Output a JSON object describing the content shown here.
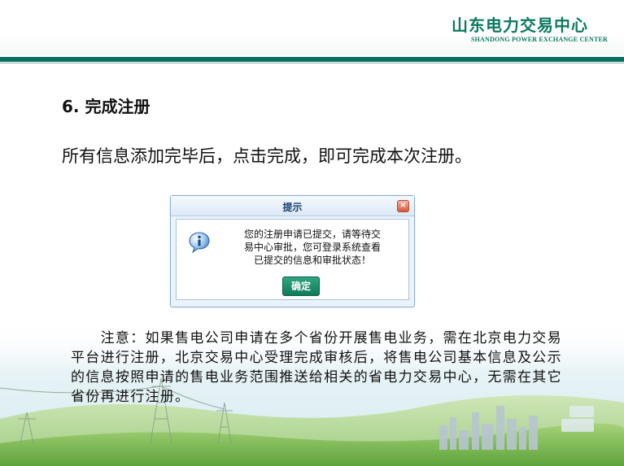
{
  "header": {
    "logo_cn": "山东电力交易中心",
    "logo_en": "SHANDONG POWER EXCHANGE CENTER"
  },
  "section": {
    "title": "6. 完成注册",
    "instruction": "所有信息添加完毕后，点击完成，即可完成本次注册。"
  },
  "dialog": {
    "title": "提示",
    "close_icon": "close-icon",
    "info_icon": "info-icon",
    "message_lines": [
      "您的注册申请已提交，请等待交",
      "易中心审批，您可登录系统查看",
      "已提交的信息和审批状态！"
    ],
    "ok_label": "确定"
  },
  "note": {
    "text": "　　注意：如果售电公司申请在多个省份开展售电业务，需在北京电力交易平台进行注册，北京交易中心受理完成审核后，将售电公司基本信息及公示的信息按照申请的售电业务范围推送给相关的省电力交易中心，无需在其它省份再进行注册。"
  },
  "colors": {
    "brand_green": "#0c7a5f",
    "rule": "#0e6e62"
  }
}
